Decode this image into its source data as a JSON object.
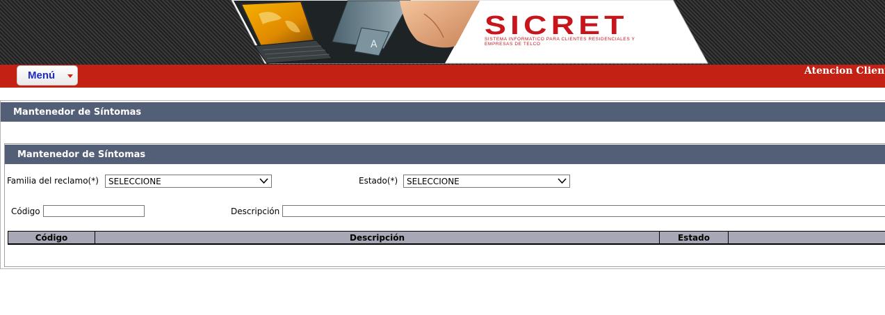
{
  "header": {
    "brand": "SICRET",
    "tagline": "Sistema informatico para clientes residenciales y empresas de telco"
  },
  "menubar": {
    "menu_label": "Menú",
    "right_text": "Atencion Cliente"
  },
  "outer_panel": {
    "title": "Mantenedor de Síntomas"
  },
  "inner_panel": {
    "title": "Mantenedor de Síntomas"
  },
  "form": {
    "familia_label": "Familia del reclamo(*)",
    "familia_value": "SELECCIONE",
    "estado_label": "Estado(*)",
    "estado_value": "SELECCIONE",
    "codigo_label": "Código",
    "codigo_value": "",
    "descripcion_label": "Descripción",
    "descripcion_value": ""
  },
  "table": {
    "columns": [
      "Código",
      "Descripción",
      "Estado",
      ""
    ],
    "rows": []
  },
  "colors": {
    "menubar_red": "#c32114",
    "panel_title_bg": "#535f76",
    "table_header_bg": "#a7a7b5",
    "brand_red": "#c8151b",
    "menu_text_blue": "#1f28c8"
  },
  "icons": [
    "menu-caret-icon",
    "chevron-down-icon"
  ]
}
